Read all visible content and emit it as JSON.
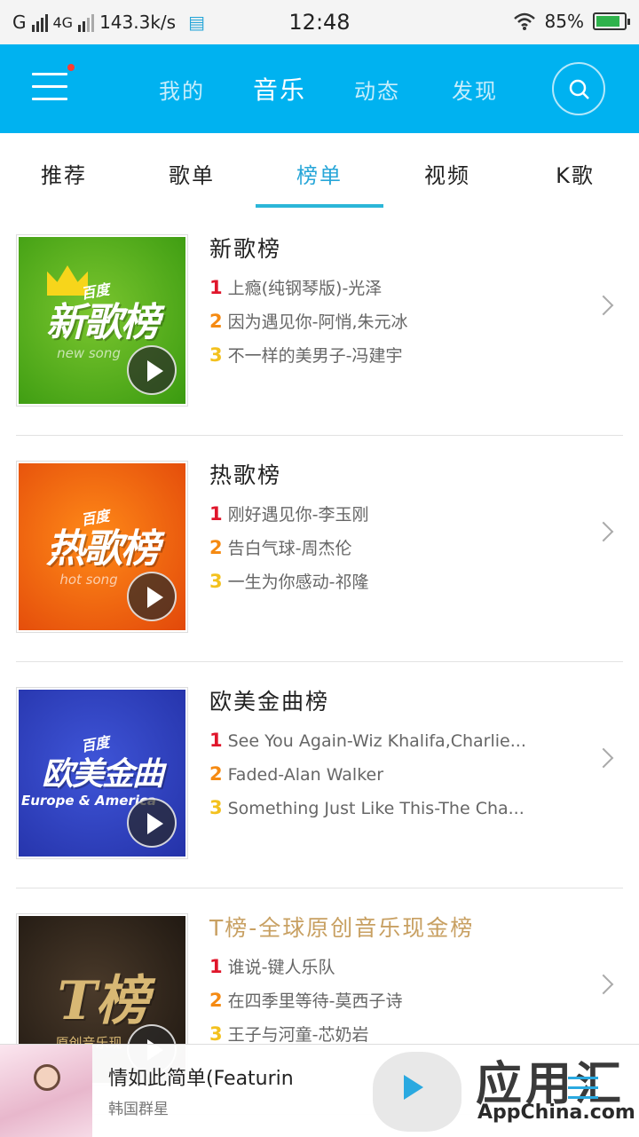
{
  "status_bar": {
    "carrier1": "G",
    "carrier2": "4G",
    "speed": "143.3k/s",
    "time": "12:48",
    "battery": "85%",
    "battery_level": 0.85
  },
  "header": {
    "tabs": [
      {
        "label": "我的"
      },
      {
        "label": "音乐"
      },
      {
        "label": "动态"
      },
      {
        "label": "发现"
      }
    ],
    "active_tab": "音乐",
    "accent_color": "#00b2f0"
  },
  "sub_tabs": [
    {
      "label": "推荐"
    },
    {
      "label": "歌单"
    },
    {
      "label": "榜单"
    },
    {
      "label": "视频"
    },
    {
      "label": "K歌"
    }
  ],
  "active_sub_tab": "榜单",
  "charts": [
    {
      "title": "新歌榜",
      "cover_brand": "百度",
      "cover_text": "新歌榜",
      "cover_sub": "new song",
      "songs": [
        {
          "rank": "1",
          "text": "上瘾(纯钢琴版)-光泽"
        },
        {
          "rank": "2",
          "text": "因为遇见你-阿悄,朱元冰"
        },
        {
          "rank": "3",
          "text": "不一样的美男子-冯建宇"
        }
      ]
    },
    {
      "title": "热歌榜",
      "cover_brand": "百度",
      "cover_text": "热歌榜",
      "cover_sub": "hot song",
      "songs": [
        {
          "rank": "1",
          "text": "刚好遇见你-李玉刚"
        },
        {
          "rank": "2",
          "text": "告白气球-周杰伦"
        },
        {
          "rank": "3",
          "text": "一生为你感动-祁隆"
        }
      ]
    },
    {
      "title": "欧美金曲榜",
      "cover_brand": "百度",
      "cover_text": "欧美金曲",
      "cover_sub": "Europe & America",
      "songs": [
        {
          "rank": "1",
          "text": "See You Again-Wiz Khalifa,Charlie..."
        },
        {
          "rank": "2",
          "text": "Faded-Alan Walker"
        },
        {
          "rank": "3",
          "text": "Something Just Like This-The Cha..."
        }
      ]
    },
    {
      "title": "T榜-全球原创音乐现金榜",
      "cover_brand": "",
      "cover_text": "T榜",
      "cover_sub": "原创音乐现",
      "songs": [
        {
          "rank": "1",
          "text": "谁说-键人乐队"
        },
        {
          "rank": "2",
          "text": "在四季里等待-莫西子诗"
        },
        {
          "rank": "3",
          "text": "王子与河童-芯奶岩"
        }
      ]
    }
  ],
  "player": {
    "song_title": "情如此简单(Featurin",
    "artist": "韩国群星",
    "watermark": "应用汇",
    "watermark_sub": "AppChina.com"
  }
}
